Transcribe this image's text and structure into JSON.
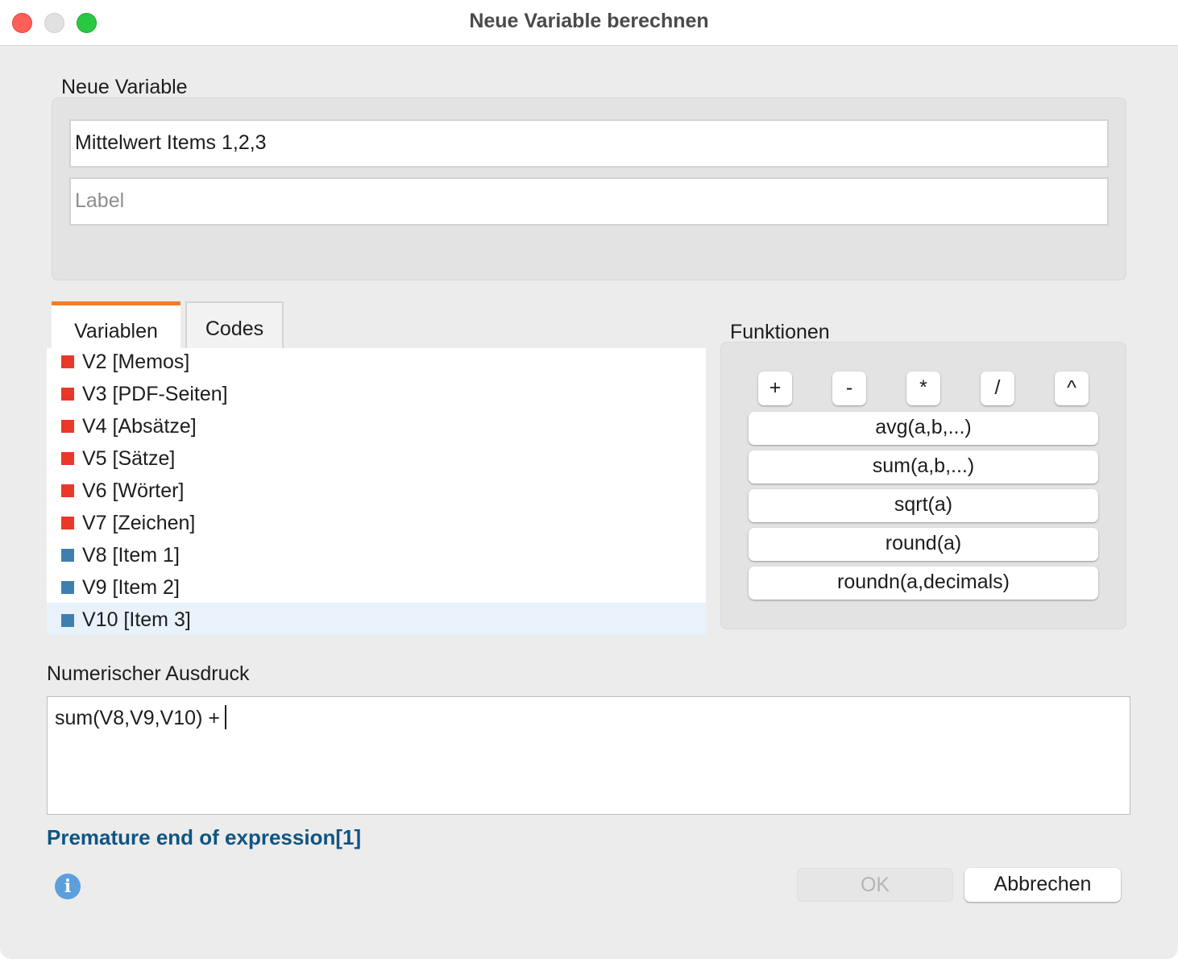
{
  "window": {
    "title": "Neue Variable berechnen"
  },
  "new_variable": {
    "group_label": "Neue Variable",
    "name_value": "Mittelwert Items 1,2,3",
    "label_placeholder": "Label"
  },
  "tabs": [
    {
      "label": "Variablen",
      "active": true
    },
    {
      "label": "Codes",
      "active": false
    }
  ],
  "variables": [
    {
      "label": "V2 [Memos]",
      "color": "#e8382a"
    },
    {
      "label": "V3 [PDF-Seiten]",
      "color": "#e8382a"
    },
    {
      "label": "V4 [Absätze]",
      "color": "#e8382a"
    },
    {
      "label": "V5 [Sätze]",
      "color": "#e8382a"
    },
    {
      "label": "V6 [Wörter]",
      "color": "#e8382a"
    },
    {
      "label": "V7 [Zeichen]",
      "color": "#e8382a"
    },
    {
      "label": "V8 [Item 1]",
      "color": "#3f7fb0"
    },
    {
      "label": "V9 [Item 2]",
      "color": "#3f7fb0"
    },
    {
      "label": "V10 [Item 3]",
      "color": "#3f7fb0",
      "selected": true
    }
  ],
  "functions": {
    "group_label": "Funktionen",
    "operators": [
      "+",
      "-",
      "*",
      "/",
      "^"
    ],
    "items": [
      "avg(a,b,...)",
      "sum(a,b,...)",
      "sqrt(a)",
      "round(a)",
      "roundn(a,decimals)"
    ]
  },
  "expression": {
    "label": "Numerischer Ausdruck",
    "value": "sum(V8,V9,V10) +"
  },
  "error": {
    "message": "Premature end of expression[1]"
  },
  "buttons": {
    "ok_label": "OK",
    "cancel_label": "Abbrechen"
  },
  "icons": {
    "info": "info-icon"
  },
  "colors": {
    "tab_accent": "#f07d2d",
    "error_text": "#0e5584",
    "info_icon": "#5b9fdd"
  }
}
